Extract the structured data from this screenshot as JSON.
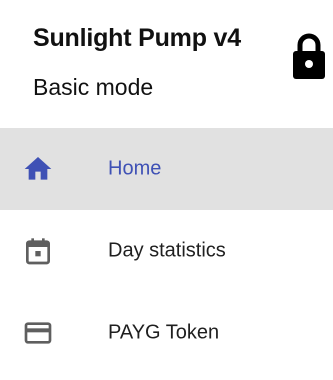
{
  "header": {
    "title": "Sunlight Pump  v4",
    "mode": "Basic mode",
    "lock_icon": "lock-icon"
  },
  "menu": {
    "items": [
      {
        "label": "Home",
        "icon": "home-icon",
        "active": true
      },
      {
        "label": "Day statistics",
        "icon": "calendar-icon",
        "active": false
      },
      {
        "label": "PAYG Token",
        "icon": "credit-card-icon",
        "active": false
      }
    ]
  },
  "colors": {
    "accent": "#3f51b5",
    "active_background": "#e1e1e1",
    "icon_gray": "#5f5f5f",
    "text": "#111111"
  }
}
